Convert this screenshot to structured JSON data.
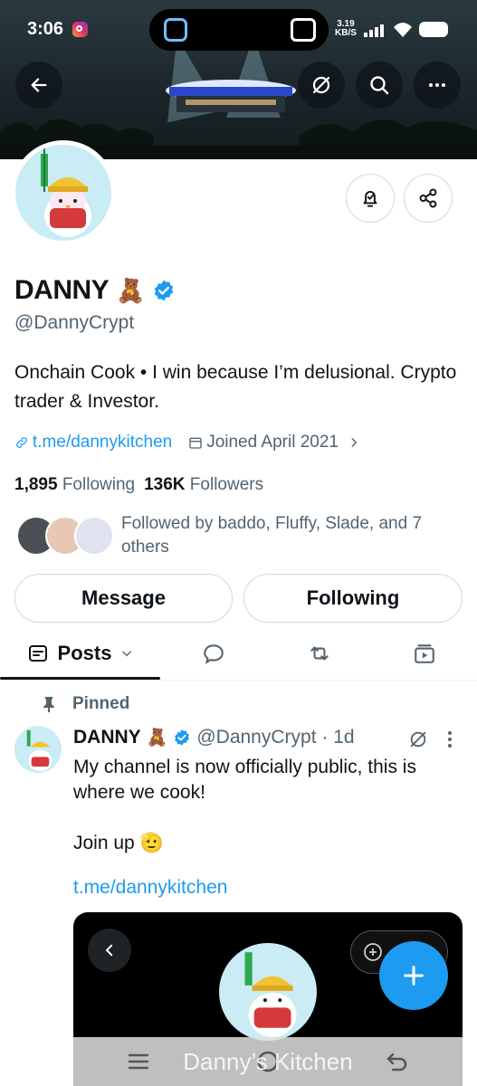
{
  "status_bar": {
    "time": "3:06",
    "net_speed_value": "3.19",
    "net_speed_unit": "KB/S"
  },
  "header_icons": [
    "back-arrow-icon",
    "grok-icon",
    "search-icon",
    "more-icon"
  ],
  "profile": {
    "name": "DANNY",
    "name_emoji": "🧸",
    "handle": "@DannyCrypt",
    "bio": "Onchain Cook • I win because I’m delusional. Crypto trader & Investor.",
    "link": "t.me/dannykitchen",
    "joined": "Joined April 2021",
    "following_count": "1,895",
    "following_label": "Following",
    "followers_count": "136K",
    "followers_label": "Followers",
    "followed_by": "Followed by baddo, Fluffy, Slade, and 7 others"
  },
  "buttons": {
    "message": "Message",
    "following": "Following"
  },
  "tabs": {
    "posts": "Posts"
  },
  "pinned_post": {
    "pinned_label": "Pinned",
    "author": "DANNY",
    "author_emoji": "🧸",
    "handle_time": "@DannyCrypt · 1d",
    "text_line1": "My channel is now officially public, this is where we cook!",
    "text_line2": "Join up 🫡",
    "link": "t.me/dannykitchen",
    "media_title": "Danny’s Kitchen"
  },
  "colors": {
    "accent": "#1d9bf0",
    "text_primary": "#0f1419",
    "text_secondary": "#536471",
    "border": "#cfd9de"
  }
}
